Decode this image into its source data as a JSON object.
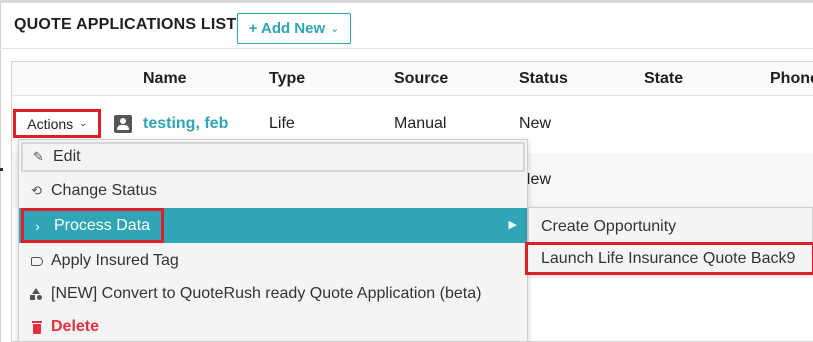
{
  "header": {
    "title": "QUOTE APPLICATIONS LIST",
    "add_new_label": "+ Add New",
    "add_new_chevron": "⌄"
  },
  "table": {
    "columns": [
      "Name",
      "Type",
      "Source",
      "Status",
      "State",
      "Phone"
    ],
    "rows": [
      {
        "actions_label": "Actions",
        "name": "testing, feb",
        "type": "Life",
        "source": "Manual",
        "status": "New"
      },
      {
        "status": "New"
      }
    ]
  },
  "actions_menu": {
    "items": [
      {
        "label": "Edit",
        "icon": "edit-icon"
      },
      {
        "label": "Change Status",
        "icon": "refresh-icon"
      },
      {
        "label": "Process Data",
        "icon": "chevron-right-icon",
        "has_submenu": true
      },
      {
        "label": "Apply Insured Tag",
        "icon": "tag-icon"
      },
      {
        "label": "[NEW] Convert to QuoteRush ready Quote Application (beta)",
        "icon": "shapes-icon"
      },
      {
        "label": "Delete",
        "icon": "trash-icon"
      }
    ]
  },
  "process_data_submenu": {
    "items": [
      {
        "label": "Create Opportunity"
      },
      {
        "label": "Launch Life Insurance Quote Back9"
      }
    ]
  },
  "colors": {
    "accent": "#2fa5b5",
    "highlight_outline": "#e01e2b",
    "delete": "#e2323f"
  }
}
